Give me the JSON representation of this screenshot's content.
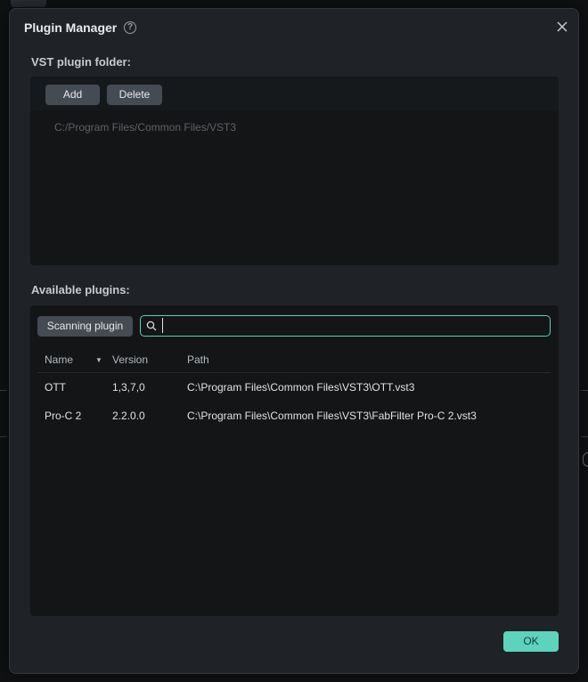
{
  "dialog": {
    "title": "Plugin Manager",
    "help_icon": "question-circle-icon",
    "close_icon": "close-icon"
  },
  "vst_folder": {
    "label": "VST plugin folder:",
    "add_label": "Add",
    "delete_label": "Delete",
    "folders": [
      "C:/Program Files/Common Files/VST3"
    ]
  },
  "available": {
    "label": "Available plugins:",
    "scan_label": "Scanning plugin",
    "search": {
      "value": "",
      "placeholder": ""
    },
    "columns": {
      "name": "Name",
      "version": "Version",
      "path": "Path"
    },
    "sort_icon": "sort-down-icon",
    "rows": [
      {
        "name": "OTT",
        "version": "1,3,7,0",
        "path": "C:\\Program Files\\Common Files\\VST3\\OTT.vst3"
      },
      {
        "name": "Pro-C 2",
        "version": "2.2.0.0",
        "path": "C:\\Program Files\\Common Files\\VST3\\FabFilter Pro-C 2.vst3"
      }
    ]
  },
  "footer": {
    "ok_label": "OK"
  },
  "colors": {
    "accent": "#5dd3bd",
    "dialog_bg": "#1f2226",
    "panel_bg": "#131517",
    "button_bg": "#454b52"
  }
}
